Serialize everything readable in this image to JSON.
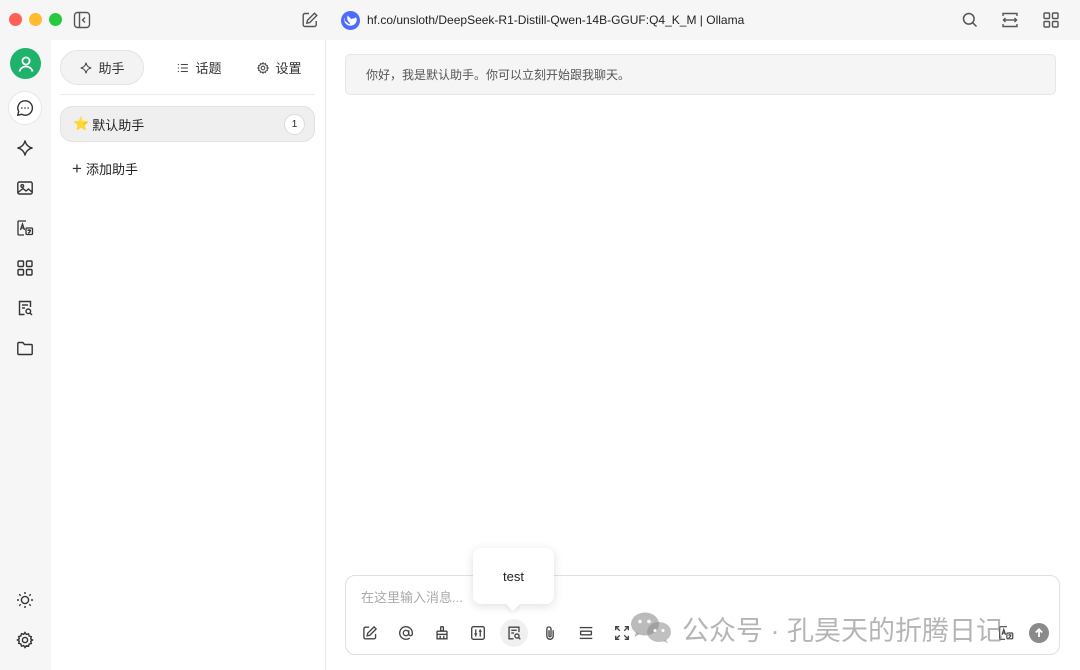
{
  "window": {
    "model_title": "hf.co/unsloth/DeepSeek-R1-Distill-Qwen-14B-GGUF:Q4_K_M | Ollama"
  },
  "sidebar": {
    "tabs": [
      {
        "label": "助手",
        "icon": "sparkle-icon"
      },
      {
        "label": "话题",
        "icon": "list-icon"
      },
      {
        "label": "设置",
        "icon": "gear-icon"
      }
    ],
    "assistant": {
      "emoji": "⭐️",
      "name": "默认助手",
      "count": "1"
    },
    "add_assistant": "添加助手"
  },
  "chat": {
    "welcome": "你好，我是默认助手。你可以立刻开始跟我聊天。",
    "input_placeholder": "在这里输入消息...",
    "tooltip": "test"
  },
  "watermark": {
    "text": "公众号 · 孔昊天的折腾日记"
  },
  "colors": {
    "avatar": "#1fb26b",
    "model_logo": "#4d6bfe",
    "traffic_red": "#ff5f57",
    "traffic_yellow": "#febc2e",
    "traffic_green": "#28c840"
  }
}
